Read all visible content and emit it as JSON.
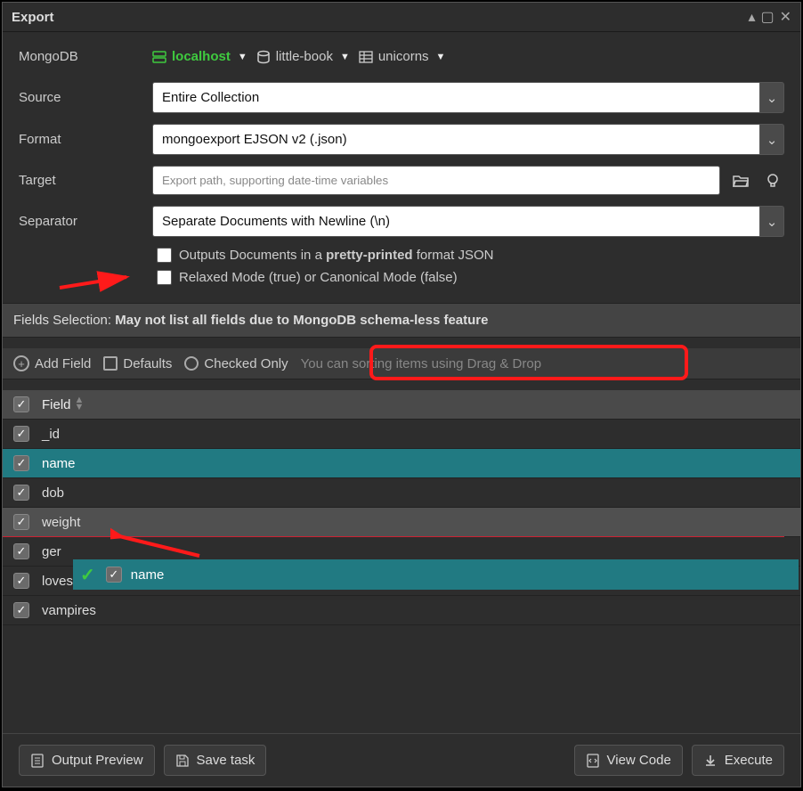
{
  "title": "Export",
  "crumbs": {
    "label": "MongoDB",
    "host": "localhost",
    "db": "little-book",
    "coll": "unicorns"
  },
  "form": {
    "sourceLabel": "Source",
    "sourceValue": "Entire Collection",
    "formatLabel": "Format",
    "formatValue": "mongoexport EJSON v2 (.json)",
    "targetLabel": "Target",
    "targetPlaceholder": "Export path, supporting date-time variables",
    "separatorLabel": "Separator",
    "separatorValue": "Separate Documents with Newline (\\n)",
    "prettyPrefix": "Outputs Documents in a ",
    "prettyBold": "pretty-printed",
    "prettySuffix": " format JSON",
    "relaxedLabel": "Relaxed Mode (true) or Canonical Mode (false)"
  },
  "fieldsSection": {
    "prefix": "Fields Selection: ",
    "bold": "May not list all fields due to MongoDB schema-less feature",
    "addField": "Add Field",
    "defaults": "Defaults",
    "checkedOnly": "Checked Only",
    "hint": "You can sorting items using Drag & Drop",
    "headerField": "Field"
  },
  "rows": [
    {
      "name": "_id",
      "sel": false,
      "hover": false
    },
    {
      "name": "name",
      "sel": true,
      "hover": false
    },
    {
      "name": "dob",
      "sel": false,
      "hover": false
    },
    {
      "name": "weight",
      "sel": false,
      "hover": true
    },
    {
      "name": "ger",
      "sel": false,
      "hover": false
    },
    {
      "name": "loves",
      "sel": false,
      "hover": false
    },
    {
      "name": "vampires",
      "sel": false,
      "hover": false
    }
  ],
  "dragGhost": {
    "label": "name"
  },
  "buttons": {
    "outputPreview": "Output Preview",
    "saveTask": "Save task",
    "viewCode": "View Code",
    "execute": "Execute"
  }
}
